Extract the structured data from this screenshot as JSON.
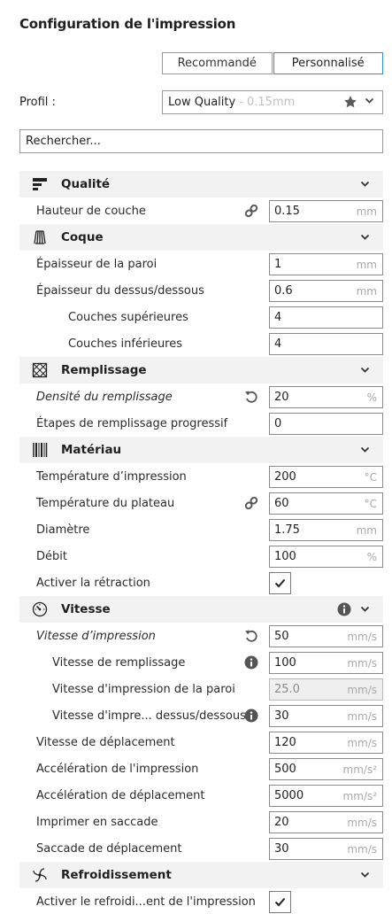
{
  "header": {
    "title": "Configuration de l'impression"
  },
  "mode": {
    "recommended": "Recommandé",
    "custom": "Personnalisé"
  },
  "profile": {
    "label": "Profil :",
    "name": "Low Quality",
    "detail": "- 0.15mm"
  },
  "search": {
    "placeholder": "Rechercher..."
  },
  "sections": {
    "quality": {
      "label": "Qualité",
      "layer_height": {
        "label": "Hauteur de couche",
        "value": "0.15",
        "unit": "mm"
      }
    },
    "shell": {
      "label": "Coque",
      "wall_thickness": {
        "label": "Épaisseur de la paroi",
        "value": "1",
        "unit": "mm"
      },
      "top_bottom_thickness": {
        "label": "Épaisseur du dessus/dessous",
        "value": "0.6",
        "unit": "mm"
      },
      "top_layers": {
        "label": "Couches supérieures",
        "value": "4"
      },
      "bottom_layers": {
        "label": "Couches inférieures",
        "value": "4"
      }
    },
    "infill": {
      "label": "Remplissage",
      "density": {
        "label": "Densité du remplissage",
        "value": "20",
        "unit": "%"
      },
      "gradual_steps": {
        "label": "Étapes de remplissage progressif",
        "value": "0"
      }
    },
    "material": {
      "label": "Matériau",
      "print_temp": {
        "label": "Température d’impression",
        "value": "200",
        "unit": "°C"
      },
      "bed_temp": {
        "label": "Température du plateau",
        "value": "60",
        "unit": "°C"
      },
      "diameter": {
        "label": "Diamètre",
        "value": "1.75",
        "unit": "mm"
      },
      "flow": {
        "label": "Débit",
        "value": "100",
        "unit": "%"
      },
      "retraction": {
        "label": "Activer la rétraction",
        "checked": true
      }
    },
    "speed": {
      "label": "Vitesse",
      "print_speed": {
        "label": "Vitesse d’impression",
        "value": "50",
        "unit": "mm/s"
      },
      "infill_speed": {
        "label": "Vitesse de remplissage",
        "value": "100",
        "unit": "mm/s"
      },
      "wall_speed": {
        "label": "Vitesse d'impression de la paroi",
        "value": "25.0",
        "unit": "mm/s"
      },
      "topbottom_speed": {
        "label": "Vitesse d'impre... dessus/dessous",
        "value": "30",
        "unit": "mm/s"
      },
      "travel_speed": {
        "label": "Vitesse de déplacement",
        "value": "120",
        "unit": "mm/s"
      },
      "print_accel": {
        "label": "Accélération de l'impression",
        "value": "500",
        "unit": "mm/s²"
      },
      "travel_accel": {
        "label": "Accélération de déplacement",
        "value": "5000",
        "unit": "mm/s²"
      },
      "print_jerk": {
        "label": "Imprimer en saccade",
        "value": "20",
        "unit": "mm/s"
      },
      "travel_jerk": {
        "label": "Saccade de déplacement",
        "value": "30",
        "unit": "mm/s"
      }
    },
    "cooling": {
      "label": "Refroidissement",
      "enable_cooling": {
        "label": "Activer le refroidi...ent de l'impression",
        "checked": true
      }
    }
  },
  "icons": {
    "link": "link-icon",
    "reset": "reset-icon",
    "info": "info-icon",
    "star": "star-icon",
    "chevron": "chevron-down-icon"
  },
  "colors": {
    "accent": "#2d8fd5",
    "category_bg": "#f2f2f2",
    "unit_text": "#a8a8a8"
  }
}
